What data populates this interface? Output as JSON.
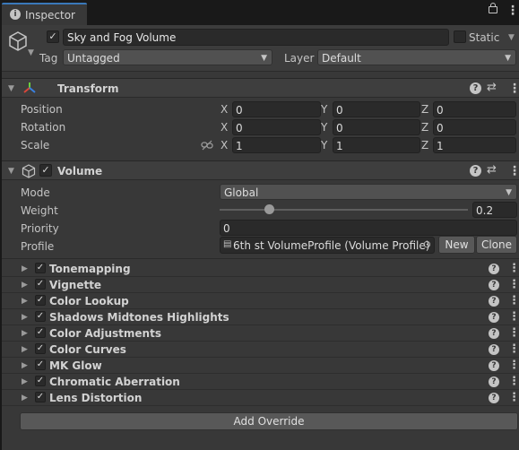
{
  "tab": {
    "title": "Inspector"
  },
  "gameobject": {
    "name": "Sky and Fog Volume",
    "static_label": "Static",
    "tag_label": "Tag",
    "tag_value": "Untagged",
    "layer_label": "Layer",
    "layer_value": "Default"
  },
  "transform": {
    "title": "Transform",
    "rows": [
      {
        "label": "Position",
        "x": "0",
        "y": "0",
        "z": "0"
      },
      {
        "label": "Rotation",
        "x": "0",
        "y": "0",
        "z": "0"
      },
      {
        "label": "Scale",
        "x": "1",
        "y": "1",
        "z": "1"
      }
    ],
    "axis": {
      "x": "X",
      "y": "Y",
      "z": "Z"
    }
  },
  "volume": {
    "title": "Volume",
    "mode_label": "Mode",
    "mode_value": "Global",
    "weight_label": "Weight",
    "weight_value": "0.2",
    "weight_fraction": 0.2,
    "priority_label": "Priority",
    "priority_value": "0",
    "profile_label": "Profile",
    "profile_value": "6th st VolumeProfile (Volume Profile)",
    "new_label": "New",
    "clone_label": "Clone"
  },
  "overrides": [
    "Tonemapping",
    "Vignette",
    "Color Lookup",
    "Shadows Midtones Highlights",
    "Color Adjustments",
    "Color Curves",
    "MK Glow",
    "Chromatic Aberration",
    "Lens Distortion"
  ],
  "add_override_label": "Add Override"
}
